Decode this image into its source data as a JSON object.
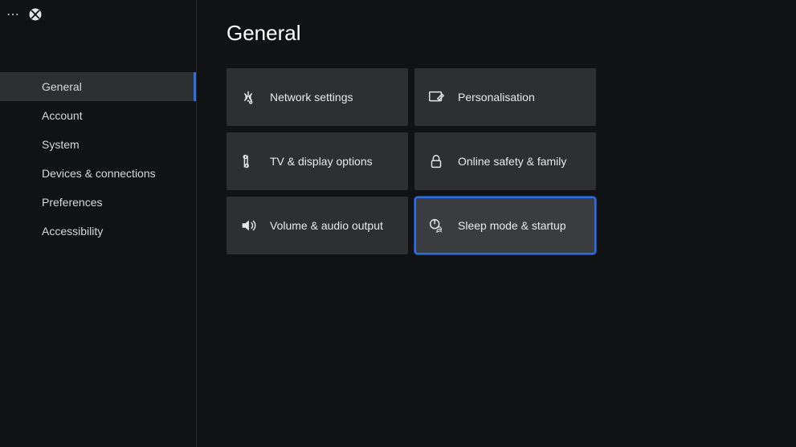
{
  "colors": {
    "accent": "#2f6fe6",
    "background": "#111213",
    "tile": "#2e2f31",
    "tileSelected": "#3b3c3f"
  },
  "header": {
    "title": "General"
  },
  "sidebar": {
    "activeIndex": 0,
    "items": [
      {
        "id": "general",
        "label": "General"
      },
      {
        "id": "account",
        "label": "Account"
      },
      {
        "id": "system",
        "label": "System"
      },
      {
        "id": "devices",
        "label": "Devices & connections"
      },
      {
        "id": "preferences",
        "label": "Preferences"
      },
      {
        "id": "accessibility",
        "label": "Accessibility"
      }
    ]
  },
  "tiles": {
    "selectedIndex": 5,
    "items": [
      {
        "id": "network",
        "icon": "wifi-icon",
        "label": "Network settings"
      },
      {
        "id": "personalisation",
        "icon": "personalise-icon",
        "label": "Personalisation"
      },
      {
        "id": "tv",
        "icon": "tv-icon",
        "label": "TV & display options"
      },
      {
        "id": "safety",
        "icon": "lock-icon",
        "label": "Online safety & family"
      },
      {
        "id": "volume",
        "icon": "speaker-icon",
        "label": "Volume & audio output"
      },
      {
        "id": "sleep",
        "icon": "power-icon",
        "label": "Sleep mode & startup"
      }
    ]
  }
}
